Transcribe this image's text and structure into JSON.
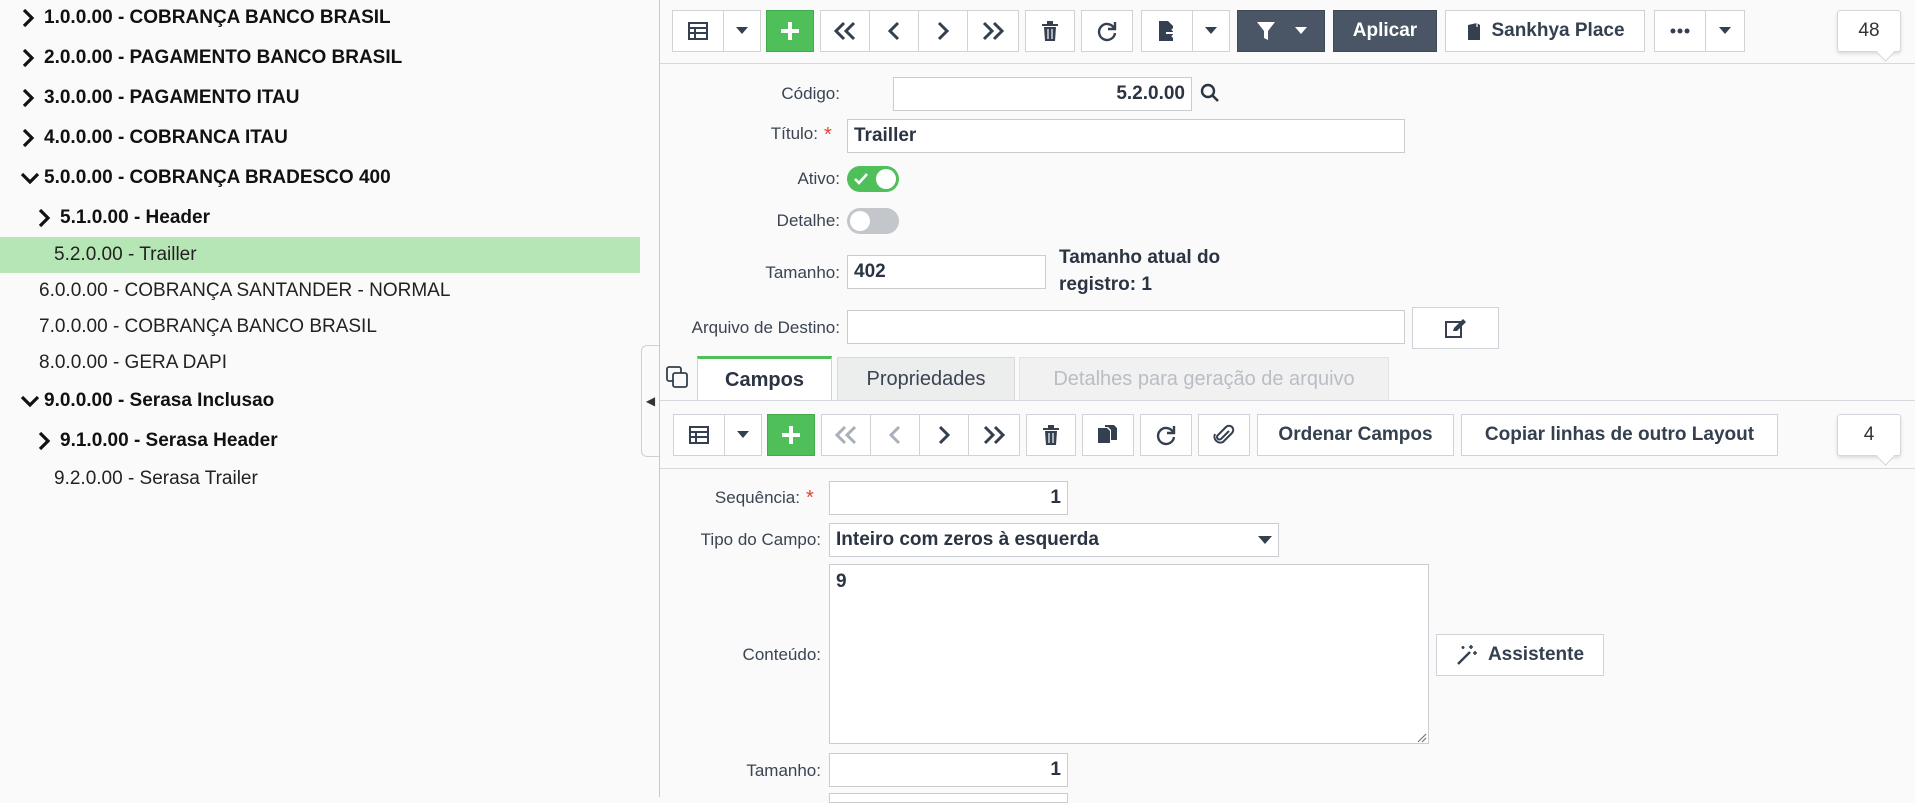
{
  "tree": {
    "items": [
      {
        "label": "1.0.0.00 - COBRANÇA BANCO BRASIL",
        "expand": "right"
      },
      {
        "label": "2.0.0.00 - PAGAMENTO BANCO BRASIL",
        "expand": "right"
      },
      {
        "label": "3.0.0.00 - PAGAMENTO ITAU",
        "expand": "right"
      },
      {
        "label": "4.0.0.00 - COBRANCA ITAU",
        "expand": "right"
      },
      {
        "label": "5.0.0.00 - COBRANÇA BRADESCO 400",
        "expand": "down"
      },
      {
        "label": "5.1.0.00 - Header",
        "expand": "right"
      },
      {
        "label": "5.2.0.00 - Trailler",
        "expand": "none",
        "selected": true
      },
      {
        "label": "6.0.0.00 - COBRANÇA SANTANDER - NORMAL",
        "expand": "none"
      },
      {
        "label": "7.0.0.00 - COBRANÇA BANCO BRASIL",
        "expand": "none"
      },
      {
        "label": "8.0.0.00 - GERA DAPI",
        "expand": "none"
      },
      {
        "label": "9.0.0.00 - Serasa Inclusao",
        "expand": "down"
      },
      {
        "label": "9.1.0.00 - Serasa Header",
        "expand": "right"
      },
      {
        "label": "9.2.0.00 - Serasa Trailer",
        "expand": "none"
      }
    ]
  },
  "toolbar": {
    "apply_label": "Aplicar",
    "place_label": "Sankhya Place",
    "counter": "48"
  },
  "form": {
    "codigo_label": "Código:",
    "codigo_value": "5.2.0.00",
    "titulo_label": "Título:",
    "titulo_value": "Trailler",
    "ativo_label": "Ativo:",
    "ativo_on": true,
    "detalhe_label": "Detalhe:",
    "detalhe_on": false,
    "tamanho_label": "Tamanho:",
    "tamanho_value": "402",
    "tamanho_note_line1": "Tamanho atual do",
    "tamanho_note_line2": "registro: 1",
    "arquivo_label": "Arquivo de Destino:",
    "arquivo_value": ""
  },
  "tabs": [
    {
      "label": "Campos",
      "state": "active"
    },
    {
      "label": "Propriedades",
      "state": "normal"
    },
    {
      "label": "Detalhes para geração de arquivo",
      "state": "disabled"
    }
  ],
  "sub_toolbar": {
    "order_label": "Ordenar Campos",
    "copy_label": "Copiar linhas de outro Layout",
    "counter": "4"
  },
  "sub_form": {
    "sequencia_label": "Sequência:",
    "sequencia_value": "1",
    "tipo_label": "Tipo do Campo:",
    "tipo_value": "Inteiro com zeros à esquerda",
    "conteudo_label": "Conteúdo:",
    "conteudo_value": "9",
    "assistente_label": "Assistente",
    "tamanho_label": "Tamanho:",
    "tamanho_value": "1"
  },
  "colors": {
    "accent_green": "#4fbf5a",
    "selected_row": "#b6e6b6",
    "dark_button": "#4a5565",
    "required": "#e0442e"
  }
}
